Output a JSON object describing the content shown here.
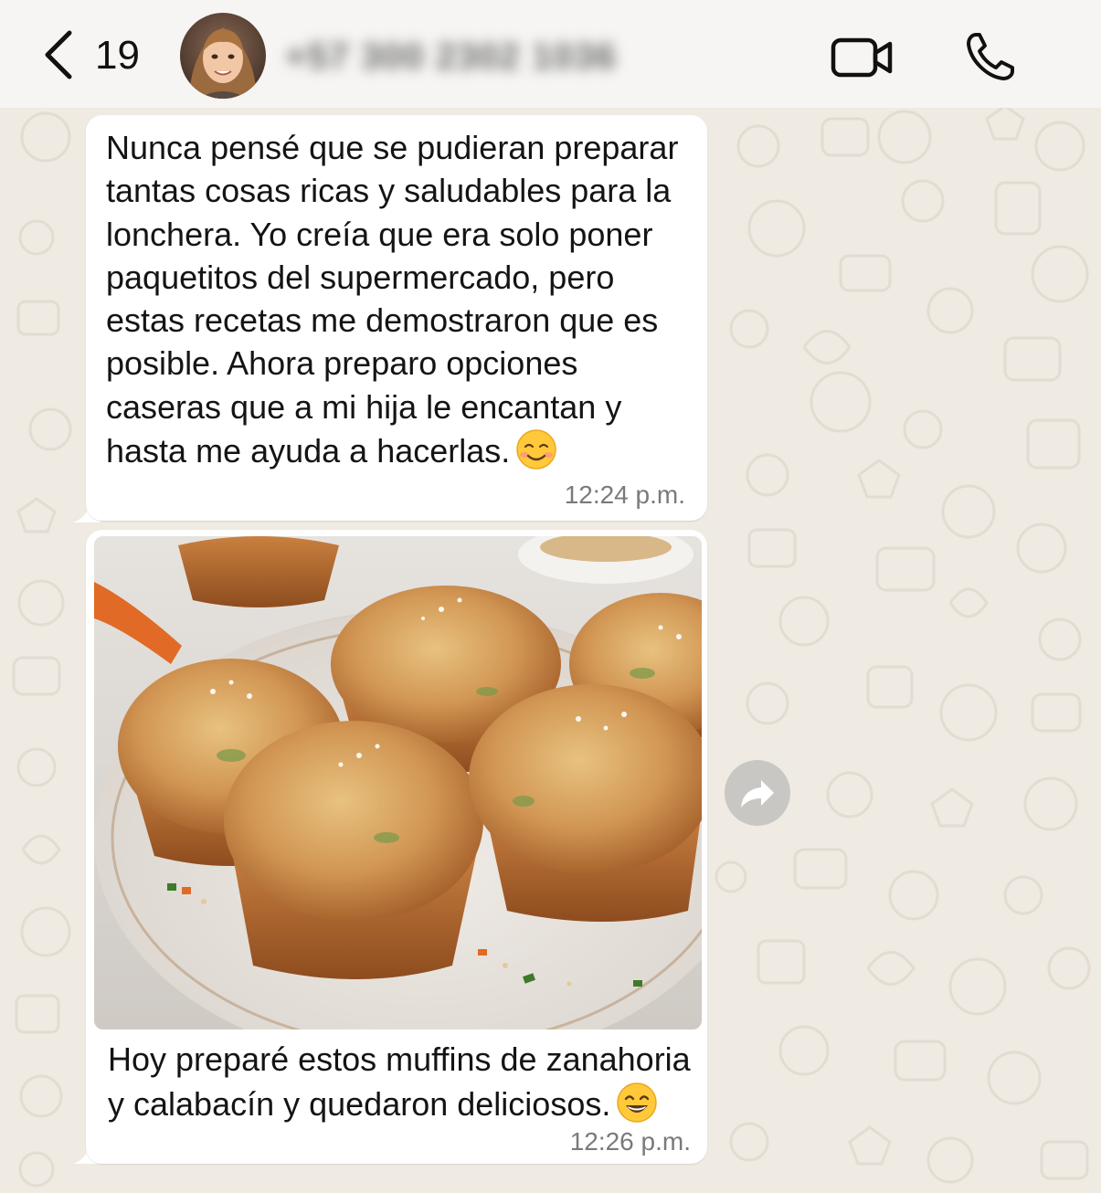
{
  "header": {
    "unread_count": "19",
    "contact_name": "+57 300 2302 1036"
  },
  "messages": [
    {
      "text": "Nunca pensé que se pudieran preparar tantas cosas ricas y saludables para la lonchera. Yo creía que era solo poner paquetitos del supermercado, pero estas recetas me demostraron que es posible. Ahora preparo opciones caseras que a mi hija le encantan y hasta me ayuda a hacerlas.",
      "emoji": "smiling-face-icon",
      "time": "12:24 p.m."
    },
    {
      "image": "muffins-photo",
      "caption": "Hoy preparé estos muffins de zanahoria y calabacín y quedaron deliciosos.",
      "emoji": "grinning-face-icon",
      "time": "12:26 p.m."
    }
  ],
  "colors": {
    "wallpaper": "#efeae2",
    "bubble": "#ffffff",
    "header": "#f6f5f3",
    "forward_button": "#c9c7c4"
  }
}
